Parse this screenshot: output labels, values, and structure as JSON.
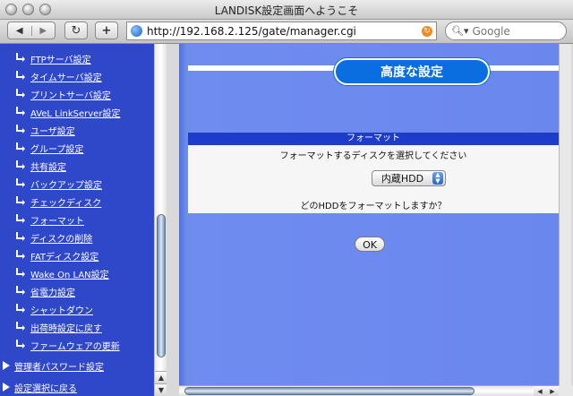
{
  "window": {
    "title": "LANDISK設定画面へようこそ"
  },
  "toolbar": {
    "url": "http://192.168.2.125/gate/manager.cgi",
    "search_placeholder": "Google",
    "back_icon": "back-arrow-icon",
    "forward_icon": "forward-arrow-icon",
    "reload_icon": "reload-icon",
    "add_icon": "add-bookmark-icon"
  },
  "sidebar": {
    "items": [
      {
        "label": "FTPサーバ設定"
      },
      {
        "label": "タイムサーバ設定"
      },
      {
        "label": "プリントサーバ設定"
      },
      {
        "label": "AVeL LinkServer設定"
      },
      {
        "label": "ユーザ設定"
      },
      {
        "label": "グループ設定"
      },
      {
        "label": "共有設定"
      },
      {
        "label": "バックアップ設定"
      },
      {
        "label": "チェックディスク"
      },
      {
        "label": "フォーマット"
      },
      {
        "label": "ディスクの削除"
      },
      {
        "label": "FATディスク設定"
      },
      {
        "label": "Wake On LAN設定"
      },
      {
        "label": "省電力設定"
      },
      {
        "label": "シャットダウン"
      },
      {
        "label": "出荷時設定に戻す"
      },
      {
        "label": "ファームウェアの更新"
      }
    ],
    "sections": [
      {
        "label": "管理者パスワード設定"
      },
      {
        "label": "設定選択に戻る"
      }
    ]
  },
  "main": {
    "header": "高度な設定",
    "panel_title": "フォーマット",
    "instruction": "フォーマットするディスクを選択してください",
    "disk_select": {
      "value": "内蔵HDD"
    },
    "question": "どのHDDをフォーマットしますか？",
    "ok_label": "OK"
  },
  "colors": {
    "sidebar_bg": "#2e48c9",
    "main_bg": "#6f8cf0",
    "header_pill": "#0a6de0",
    "panel_head": "#1c3cc9"
  }
}
